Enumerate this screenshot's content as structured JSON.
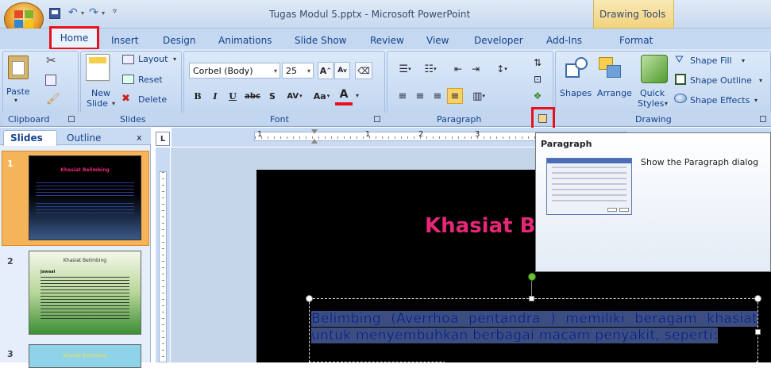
{
  "window": {
    "title": "Tugas Modul 5.pptx - Microsoft PowerPoint",
    "context_tab": "Drawing Tools"
  },
  "tabs": [
    "Home",
    "Insert",
    "Design",
    "Animations",
    "Slide Show",
    "Review",
    "View",
    "Developer",
    "Add-Ins",
    "Format"
  ],
  "clipboard": {
    "paste": "Paste",
    "label": "Clipboard"
  },
  "slides_group": {
    "layout": "Layout",
    "reset": "Reset",
    "new_slide_1": "New",
    "new_slide_2": "Slide",
    "delete": "Delete",
    "label": "Slides"
  },
  "font": {
    "name": "Corbel (Body)",
    "size": "25",
    "label": "Font",
    "bold": "B",
    "italic": "I",
    "underline": "U",
    "strike": "abc",
    "shadow": "S",
    "spacing": "AV",
    "case": "Aa",
    "color": "A"
  },
  "paragraph": {
    "label": "Paragraph"
  },
  "drawing": {
    "shapes": "Shapes",
    "arrange": "Arrange",
    "quick_1": "Quick",
    "quick_2": "Styles",
    "fill": "Shape Fill",
    "outline": "Shape Outline",
    "effects": "Shape Effects",
    "label": "Drawing"
  },
  "panel": {
    "tab_slides": "Slides",
    "tab_outline": "Outline",
    "close": "x"
  },
  "thumbs": [
    {
      "num": "1",
      "title": "Khasiat Belimbing"
    },
    {
      "num": "2",
      "title": "Khasiat Belimbing",
      "sub": "Jawaal"
    },
    {
      "num": "3",
      "title": "Khasiat Belimbing"
    }
  ],
  "tooltip": {
    "title": "Paragraph",
    "desc": "Show the Paragraph dialog"
  },
  "slide": {
    "title": "Khasiat Be",
    "body": "Belimbing (Averrhoa pentandra ) memiliki beragam khasiat untuk menyembuhkan berbagai macam penyakit, seperti:"
  },
  "ruler": [
    "1",
    "1",
    "2",
    "3"
  ],
  "colors": {
    "accent_red": "#e8101b",
    "title_pink": "#e62777",
    "body_blue": "#1f3a9c"
  }
}
